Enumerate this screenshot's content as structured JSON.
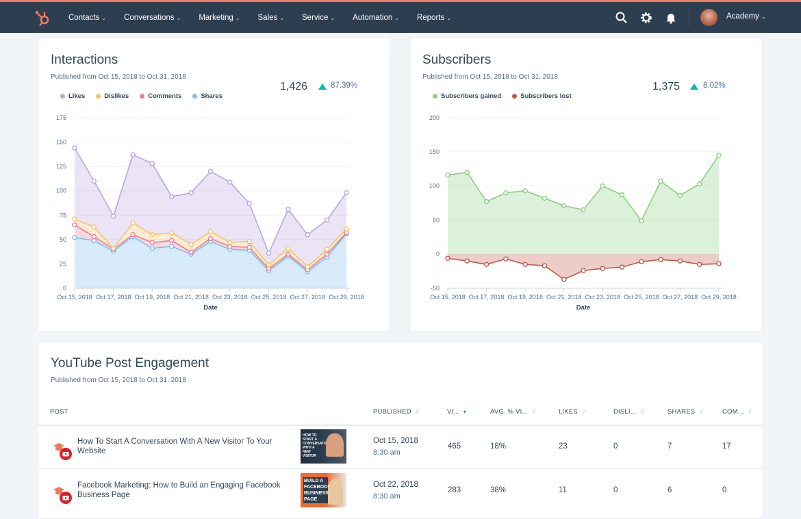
{
  "nav": {
    "items": [
      "Contacts",
      "Conversations",
      "Marketing",
      "Sales",
      "Service",
      "Automation",
      "Reports"
    ],
    "account": "Academy",
    "icons": [
      "sprocket-logo-icon",
      "search-icon",
      "gear-icon",
      "bell-icon",
      "avatar"
    ],
    "colors": {
      "nav_bg": "#2d3e50",
      "accent": "#f2795b"
    }
  },
  "interactions": {
    "title": "Interactions",
    "subtitle": "Published from Oct 15, 2018 to Oct 31, 2018",
    "kpi": "1,426",
    "kpi_change": "87.39%",
    "legend": [
      "Likes",
      "Dislikes",
      "Comments",
      "Shares"
    ]
  },
  "subscribers": {
    "title": "Subscribers",
    "subtitle": "Published from Oct 15, 2018 to Oct 31, 2018",
    "kpi": "1,375",
    "kpi_change": "8.02%",
    "legend": [
      "Subscribers gained",
      "Subscribers lost"
    ]
  },
  "chart_data": [
    {
      "type": "area",
      "stacked": true,
      "xlabel": "Date",
      "ylabel": "",
      "ylim": [
        0,
        175
      ],
      "yticks": [
        0,
        25,
        50,
        75,
        100,
        125,
        150,
        175
      ],
      "x": [
        "Oct 15, 2018",
        "Oct 16, 2018",
        "Oct 17, 2018",
        "Oct 18, 2018",
        "Oct 19, 2018",
        "Oct 20, 2018",
        "Oct 21, 2018",
        "Oct 22, 2018",
        "Oct 23, 2018",
        "Oct 24, 2018",
        "Oct 25, 2018",
        "Oct 26, 2018",
        "Oct 27, 2018",
        "Oct 28, 2018",
        "Oct 29, 2018"
      ],
      "xtick_labels": [
        "Oct 15, 2018",
        "Oct 17, 2018",
        "Oct 19, 2018",
        "Oct 21, 2018",
        "Oct 23, 2018",
        "Oct 25, 2018",
        "Oct 27, 2018",
        "Oct 29, 2018"
      ],
      "legend": "top-left",
      "series": [
        {
          "name": "Shares",
          "color": "#7fbdf0",
          "values": [
            52,
            49,
            38,
            53,
            41,
            43,
            35,
            48,
            40,
            39,
            18,
            33,
            17,
            32,
            56
          ]
        },
        {
          "name": "Comments",
          "color": "#ea7e96",
          "values": [
            13,
            4,
            2,
            2,
            6,
            6,
            2,
            3,
            3,
            3,
            2,
            2,
            2,
            3,
            1
          ]
        },
        {
          "name": "Dislikes",
          "color": "#f5c26b",
          "values": [
            6,
            10,
            1,
            12,
            8,
            8,
            8,
            7,
            4,
            6,
            4,
            6,
            3,
            5,
            4
          ]
        },
        {
          "name": "Likes",
          "color": "#b9a6e0",
          "values": [
            73,
            47,
            33,
            70,
            73,
            37,
            53,
            62,
            62,
            39,
            12,
            40,
            33,
            30,
            37
          ]
        }
      ]
    },
    {
      "type": "area",
      "stacked": false,
      "xlabel": "Date",
      "ylabel": "",
      "ylim": [
        -50,
        200
      ],
      "yticks": [
        -50,
        0,
        50,
        100,
        150,
        200
      ],
      "x": [
        "Oct 15, 2018",
        "Oct 16, 2018",
        "Oct 17, 2018",
        "Oct 18, 2018",
        "Oct 19, 2018",
        "Oct 20, 2018",
        "Oct 21, 2018",
        "Oct 22, 2018",
        "Oct 23, 2018",
        "Oct 24, 2018",
        "Oct 25, 2018",
        "Oct 26, 2018",
        "Oct 27, 2018",
        "Oct 28, 2018",
        "Oct 29, 2018"
      ],
      "xtick_labels": [
        "Oct 15, 2018",
        "Oct 17, 2018",
        "Oct 19, 2018",
        "Oct 21, 2018",
        "Oct 23, 2018",
        "Oct 25, 2018",
        "Oct 27, 2018",
        "Oct 29, 2018"
      ],
      "legend": "top-left",
      "series": [
        {
          "name": "Subscribers gained",
          "color": "#8ccf80",
          "values": [
            116,
            120,
            77,
            90,
            93,
            82,
            71,
            65,
            100,
            87,
            49,
            107,
            86,
            103,
            145
          ]
        },
        {
          "name": "Subscribers lost",
          "color": "#c0584a",
          "values": [
            -6,
            -10,
            -15,
            -7,
            -15,
            -17,
            -37,
            -24,
            -21,
            -19,
            -11,
            -8,
            -10,
            -15,
            -14
          ]
        }
      ]
    }
  ],
  "youtube": {
    "title": "YouTube Post Engagement",
    "subtitle": "Published from Oct 15, 2018 to Oct 31, 2018",
    "columns": [
      "POST",
      "PUBLISHED",
      "VI...",
      "AVG. % VI...",
      "LIKES",
      "DISLI...",
      "SHARES",
      "COM..."
    ],
    "sorted_column": "VI...",
    "rows": [
      {
        "post": "How To Start A Conversation With A New Visitor To Your Website",
        "thumb_text": "HOW TO START A CONVERSATION WITH A NEW VISITOR",
        "date": "Oct 15, 2018",
        "time": "8:30 am",
        "views": "465",
        "avg": "18%",
        "likes": "23",
        "dislikes": "0",
        "shares": "7",
        "comments": "17"
      },
      {
        "post": "Facebook Marketing: How to Build an Engaging Facebook Business Page",
        "thumb_text": "BUILD A FACEBOOK BUSINESS PAGE",
        "date": "Oct 22, 2018",
        "time": "8:30 am",
        "views": "283",
        "avg": "38%",
        "likes": "11",
        "dislikes": "0",
        "shares": "6",
        "comments": "0"
      }
    ]
  }
}
